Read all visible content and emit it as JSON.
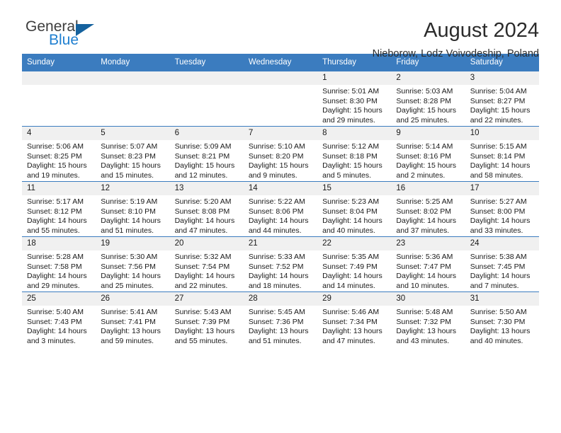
{
  "brand": {
    "name_line1": "General",
    "name_line2": "Blue",
    "accent_color": "#1f7fd0",
    "triangle_color": "#15629e"
  },
  "header": {
    "title": "August 2024",
    "location": "Nieborow, Lodz Voivodeship, Poland"
  },
  "theme": {
    "header_row_bg": "#3b7cbf",
    "daynum_bg": "#f0f0f0",
    "grid_line": "#3b7cbf"
  },
  "weekday_headers": [
    "Sunday",
    "Monday",
    "Tuesday",
    "Wednesday",
    "Thursday",
    "Friday",
    "Saturday"
  ],
  "labels": {
    "sunrise_prefix": "Sunrise:",
    "sunset_prefix": "Sunset:",
    "daylight_prefix": "Daylight:"
  },
  "weeks": [
    [
      {
        "day": "",
        "empty": true
      },
      {
        "day": "",
        "empty": true
      },
      {
        "day": "",
        "empty": true
      },
      {
        "day": "",
        "empty": true
      },
      {
        "day": "1",
        "sunrise": "Sunrise: 5:01 AM",
        "sunset": "Sunset: 8:30 PM",
        "daylight_1": "Daylight: 15 hours",
        "daylight_2": "and 29 minutes."
      },
      {
        "day": "2",
        "sunrise": "Sunrise: 5:03 AM",
        "sunset": "Sunset: 8:28 PM",
        "daylight_1": "Daylight: 15 hours",
        "daylight_2": "and 25 minutes."
      },
      {
        "day": "3",
        "sunrise": "Sunrise: 5:04 AM",
        "sunset": "Sunset: 8:27 PM",
        "daylight_1": "Daylight: 15 hours",
        "daylight_2": "and 22 minutes."
      }
    ],
    [
      {
        "day": "4",
        "sunrise": "Sunrise: 5:06 AM",
        "sunset": "Sunset: 8:25 PM",
        "daylight_1": "Daylight: 15 hours",
        "daylight_2": "and 19 minutes."
      },
      {
        "day": "5",
        "sunrise": "Sunrise: 5:07 AM",
        "sunset": "Sunset: 8:23 PM",
        "daylight_1": "Daylight: 15 hours",
        "daylight_2": "and 15 minutes."
      },
      {
        "day": "6",
        "sunrise": "Sunrise: 5:09 AM",
        "sunset": "Sunset: 8:21 PM",
        "daylight_1": "Daylight: 15 hours",
        "daylight_2": "and 12 minutes."
      },
      {
        "day": "7",
        "sunrise": "Sunrise: 5:10 AM",
        "sunset": "Sunset: 8:20 PM",
        "daylight_1": "Daylight: 15 hours",
        "daylight_2": "and 9 minutes."
      },
      {
        "day": "8",
        "sunrise": "Sunrise: 5:12 AM",
        "sunset": "Sunset: 8:18 PM",
        "daylight_1": "Daylight: 15 hours",
        "daylight_2": "and 5 minutes."
      },
      {
        "day": "9",
        "sunrise": "Sunrise: 5:14 AM",
        "sunset": "Sunset: 8:16 PM",
        "daylight_1": "Daylight: 15 hours",
        "daylight_2": "and 2 minutes."
      },
      {
        "day": "10",
        "sunrise": "Sunrise: 5:15 AM",
        "sunset": "Sunset: 8:14 PM",
        "daylight_1": "Daylight: 14 hours",
        "daylight_2": "and 58 minutes."
      }
    ],
    [
      {
        "day": "11",
        "sunrise": "Sunrise: 5:17 AM",
        "sunset": "Sunset: 8:12 PM",
        "daylight_1": "Daylight: 14 hours",
        "daylight_2": "and 55 minutes."
      },
      {
        "day": "12",
        "sunrise": "Sunrise: 5:19 AM",
        "sunset": "Sunset: 8:10 PM",
        "daylight_1": "Daylight: 14 hours",
        "daylight_2": "and 51 minutes."
      },
      {
        "day": "13",
        "sunrise": "Sunrise: 5:20 AM",
        "sunset": "Sunset: 8:08 PM",
        "daylight_1": "Daylight: 14 hours",
        "daylight_2": "and 47 minutes."
      },
      {
        "day": "14",
        "sunrise": "Sunrise: 5:22 AM",
        "sunset": "Sunset: 8:06 PM",
        "daylight_1": "Daylight: 14 hours",
        "daylight_2": "and 44 minutes."
      },
      {
        "day": "15",
        "sunrise": "Sunrise: 5:23 AM",
        "sunset": "Sunset: 8:04 PM",
        "daylight_1": "Daylight: 14 hours",
        "daylight_2": "and 40 minutes."
      },
      {
        "day": "16",
        "sunrise": "Sunrise: 5:25 AM",
        "sunset": "Sunset: 8:02 PM",
        "daylight_1": "Daylight: 14 hours",
        "daylight_2": "and 37 minutes."
      },
      {
        "day": "17",
        "sunrise": "Sunrise: 5:27 AM",
        "sunset": "Sunset: 8:00 PM",
        "daylight_1": "Daylight: 14 hours",
        "daylight_2": "and 33 minutes."
      }
    ],
    [
      {
        "day": "18",
        "sunrise": "Sunrise: 5:28 AM",
        "sunset": "Sunset: 7:58 PM",
        "daylight_1": "Daylight: 14 hours",
        "daylight_2": "and 29 minutes."
      },
      {
        "day": "19",
        "sunrise": "Sunrise: 5:30 AM",
        "sunset": "Sunset: 7:56 PM",
        "daylight_1": "Daylight: 14 hours",
        "daylight_2": "and 25 minutes."
      },
      {
        "day": "20",
        "sunrise": "Sunrise: 5:32 AM",
        "sunset": "Sunset: 7:54 PM",
        "daylight_1": "Daylight: 14 hours",
        "daylight_2": "and 22 minutes."
      },
      {
        "day": "21",
        "sunrise": "Sunrise: 5:33 AM",
        "sunset": "Sunset: 7:52 PM",
        "daylight_1": "Daylight: 14 hours",
        "daylight_2": "and 18 minutes."
      },
      {
        "day": "22",
        "sunrise": "Sunrise: 5:35 AM",
        "sunset": "Sunset: 7:49 PM",
        "daylight_1": "Daylight: 14 hours",
        "daylight_2": "and 14 minutes."
      },
      {
        "day": "23",
        "sunrise": "Sunrise: 5:36 AM",
        "sunset": "Sunset: 7:47 PM",
        "daylight_1": "Daylight: 14 hours",
        "daylight_2": "and 10 minutes."
      },
      {
        "day": "24",
        "sunrise": "Sunrise: 5:38 AM",
        "sunset": "Sunset: 7:45 PM",
        "daylight_1": "Daylight: 14 hours",
        "daylight_2": "and 7 minutes."
      }
    ],
    [
      {
        "day": "25",
        "sunrise": "Sunrise: 5:40 AM",
        "sunset": "Sunset: 7:43 PM",
        "daylight_1": "Daylight: 14 hours",
        "daylight_2": "and 3 minutes."
      },
      {
        "day": "26",
        "sunrise": "Sunrise: 5:41 AM",
        "sunset": "Sunset: 7:41 PM",
        "daylight_1": "Daylight: 13 hours",
        "daylight_2": "and 59 minutes."
      },
      {
        "day": "27",
        "sunrise": "Sunrise: 5:43 AM",
        "sunset": "Sunset: 7:39 PM",
        "daylight_1": "Daylight: 13 hours",
        "daylight_2": "and 55 minutes."
      },
      {
        "day": "28",
        "sunrise": "Sunrise: 5:45 AM",
        "sunset": "Sunset: 7:36 PM",
        "daylight_1": "Daylight: 13 hours",
        "daylight_2": "and 51 minutes."
      },
      {
        "day": "29",
        "sunrise": "Sunrise: 5:46 AM",
        "sunset": "Sunset: 7:34 PM",
        "daylight_1": "Daylight: 13 hours",
        "daylight_2": "and 47 minutes."
      },
      {
        "day": "30",
        "sunrise": "Sunrise: 5:48 AM",
        "sunset": "Sunset: 7:32 PM",
        "daylight_1": "Daylight: 13 hours",
        "daylight_2": "and 43 minutes."
      },
      {
        "day": "31",
        "sunrise": "Sunrise: 5:50 AM",
        "sunset": "Sunset: 7:30 PM",
        "daylight_1": "Daylight: 13 hours",
        "daylight_2": "and 40 minutes."
      }
    ]
  ]
}
